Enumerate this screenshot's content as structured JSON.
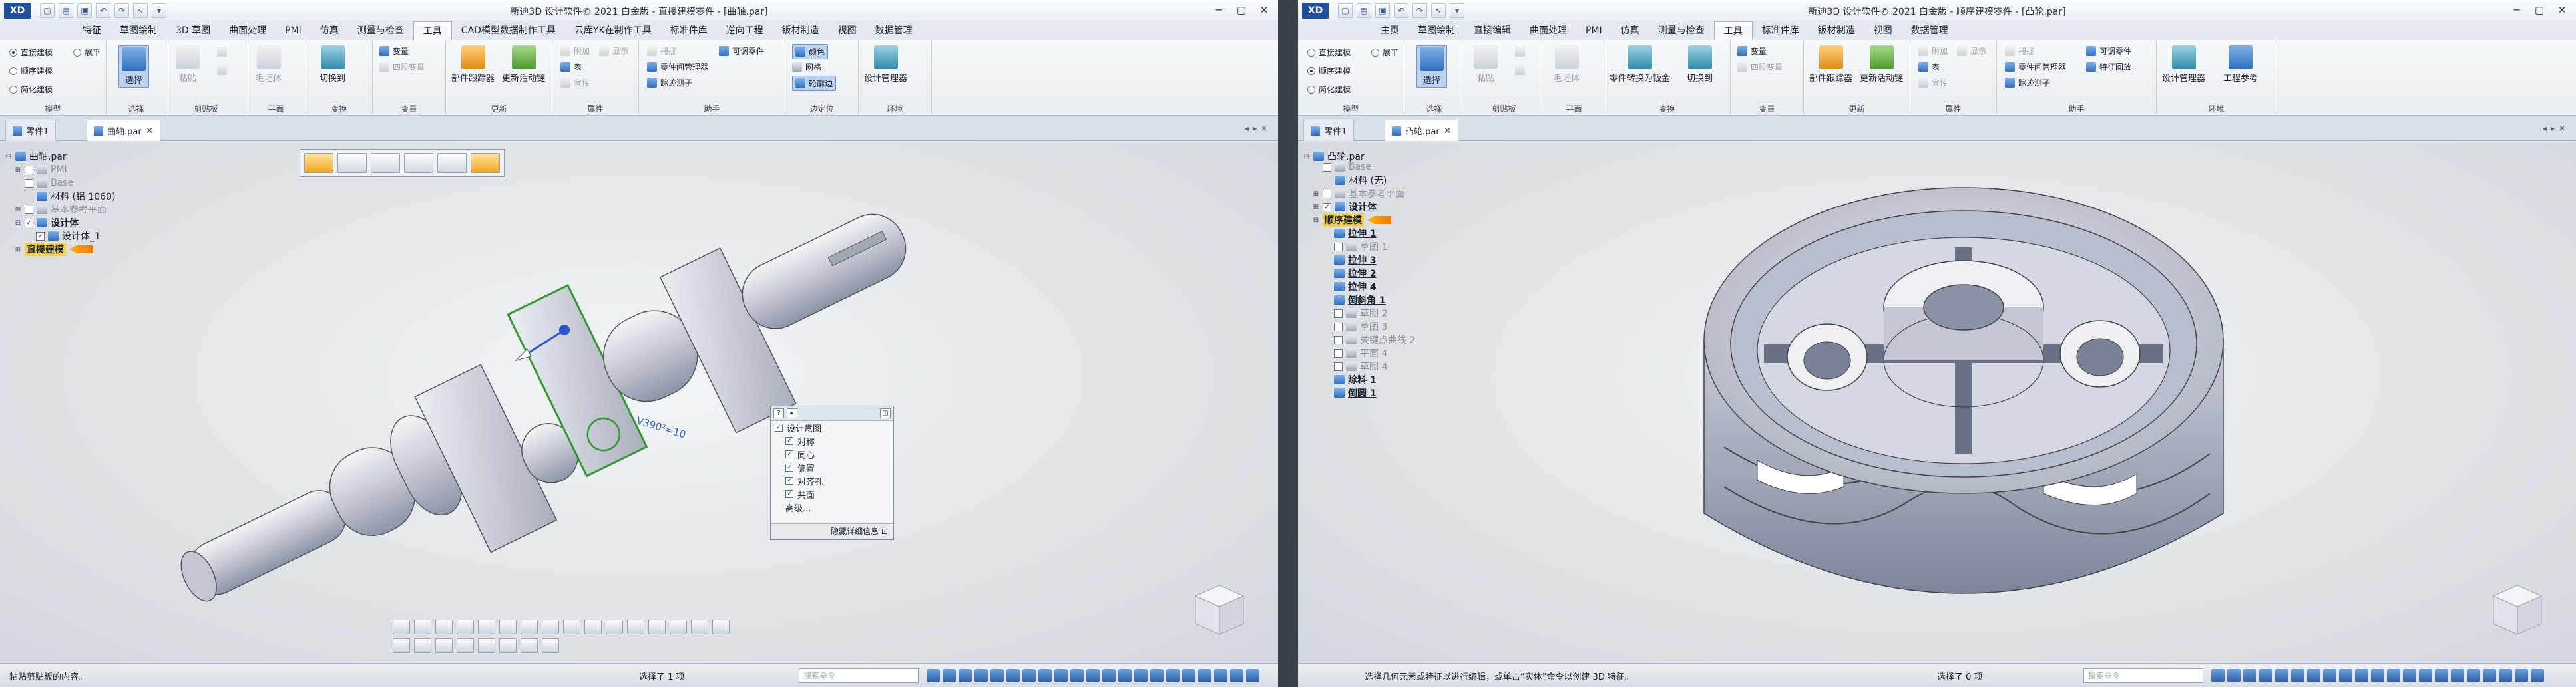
{
  "apps": [
    {
      "title": "新迪3D 设计软件© 2021 白金版 - 直接建模零件 - [曲轴.par]",
      "tabs": [
        "特征",
        "草图绘制",
        "3D 草图",
        "曲面处理",
        "PMI",
        "仿真",
        "测量与检查",
        "工具",
        "CAD模型数据制作工具",
        "云库YK在制作工具",
        "标准件库",
        "逆向工程",
        "钣材制造",
        "视图",
        "数据管理"
      ],
      "active_tab": "工具",
      "ribbon": {
        "model_group": "模型",
        "modes": [
          "直接建模",
          "顺序建模",
          "简化建模"
        ],
        "flat_label": "展平",
        "select_label": "选择",
        "select_group": "选择",
        "clipboard_group": "剪贴板",
        "paste_label": "粘贴",
        "plane_group": "平面",
        "plane_label": "毛坯体",
        "transform_group": "变换",
        "convert_label": "切换到",
        "variable_group": "变量",
        "variable_label": "变量",
        "smart_label": "四段变量",
        "update_group": "更新",
        "part_mgr_label": "部件跟踪器",
        "update_links_label": "更新活动链",
        "attr_group": "属性",
        "attr_items": [
          "附加",
          "表",
          "宣传"
        ],
        "attr_side": "显示",
        "assist_group": "助手",
        "assist_items": [
          "捕捉",
          "零件间管理器",
          "踪迹测子"
        ],
        "assist_side": "可调零件",
        "edge_group": "边定位",
        "edge_items": [
          "颜色",
          "网格",
          "轮廓边"
        ],
        "env_group": "环境",
        "env_label": "设计管理器"
      },
      "doc_tabs": [
        "零件1",
        "曲轴.par"
      ],
      "tree": [
        {
          "label": "曲轴.par",
          "level": 0
        },
        {
          "label": "PMI",
          "level": 1
        },
        {
          "label": "Base",
          "level": 1
        },
        {
          "label": "材料 (铝 1060)",
          "level": 1
        },
        {
          "label": "基本参考平面",
          "level": 1
        },
        {
          "label": "设计体",
          "level": 1
        },
        {
          "label": "设计体_1",
          "level": 2
        },
        {
          "label": "直接建模",
          "level": 1,
          "highlight": true
        }
      ],
      "panel": {
        "items": [
          "设计意图",
          "对称",
          "同心",
          "偏置",
          "对齐孔",
          "共面",
          "高级..."
        ],
        "footer": "隐藏详细信息"
      },
      "dimension": "V390²=10",
      "status": {
        "hint": "粘贴剪贴板的内容。",
        "selection": "选择了 1 项",
        "cmd_placeholder": "搜索命令"
      }
    },
    {
      "title": "新迪3D 设计软件© 2021 白金版 - 顺序建模零件 - [凸轮.par]",
      "tabs": [
        "主页",
        "草图绘制",
        "直接编辑",
        "曲面处理",
        "PMI",
        "仿真",
        "测量与检查",
        "工具",
        "标准件库",
        "钣材制造",
        "视图",
        "数据管理"
      ],
      "active_tab": "工具",
      "ribbon": {
        "model_group": "模型",
        "modes": [
          "直接建模",
          "顺序建模",
          "简化建模"
        ],
        "flat_label": "展平",
        "select_label": "选择",
        "select_group": "选择",
        "clipboard_group": "剪贴板",
        "paste_label": "粘贴",
        "plane_group": "平面",
        "plane_label": "毛坯体",
        "transform_group": "变换",
        "convert_label": "零件转换为钣金",
        "convert2_label": "切换到",
        "variable_group": "变量",
        "variable_label": "变量",
        "smart_label": "四段变量",
        "update_group": "更新",
        "part_mgr_label": "部件跟踪器",
        "update_links_label": "更新活动链",
        "attr_group": "属性",
        "attr_items": [
          "附加",
          "表",
          "宣传"
        ],
        "attr_side": "显示",
        "assist_group": "助手",
        "assist_items": [
          "捕捉",
          "零件间管理器",
          "踪迹测子"
        ],
        "assist_side": "可调零件",
        "assist_side2": "特征回放",
        "env_group": "环境",
        "env_label": "设计管理器",
        "env2_label": "工程参考"
      },
      "doc_tabs": [
        "零件1",
        "凸轮.par"
      ],
      "tree": [
        {
          "label": "凸轮.par",
          "level": 0
        },
        {
          "label": "Base",
          "level": 1
        },
        {
          "label": "材料 (无)",
          "level": 1
        },
        {
          "label": "基本参考平面",
          "level": 1
        },
        {
          "label": "设计体",
          "level": 1
        },
        {
          "label": "顺序建模",
          "level": 1,
          "highlight": true
        },
        {
          "label": "拉伸 1",
          "level": 2
        },
        {
          "label": "草图 1",
          "level": 2
        },
        {
          "label": "拉伸 3",
          "level": 2
        },
        {
          "label": "拉伸 2",
          "level": 2
        },
        {
          "label": "拉伸 4",
          "level": 2
        },
        {
          "label": "倒斜角 1",
          "level": 2
        },
        {
          "label": "草图 2",
          "level": 2
        },
        {
          "label": "草图 3",
          "level": 2
        },
        {
          "label": "关键点曲线 2",
          "level": 2
        },
        {
          "label": "平面 4",
          "level": 2
        },
        {
          "label": "草图 4",
          "level": 2
        },
        {
          "label": "除料 1",
          "level": 2
        },
        {
          "label": "倒圆 1",
          "level": 2
        }
      ],
      "status": {
        "hint": "选择几何元素或特征以进行编辑，或单击“实体”命令以创建 3D 特征。",
        "selection": "选择了 0 项",
        "cmd_placeholder": "搜索命令"
      }
    }
  ]
}
